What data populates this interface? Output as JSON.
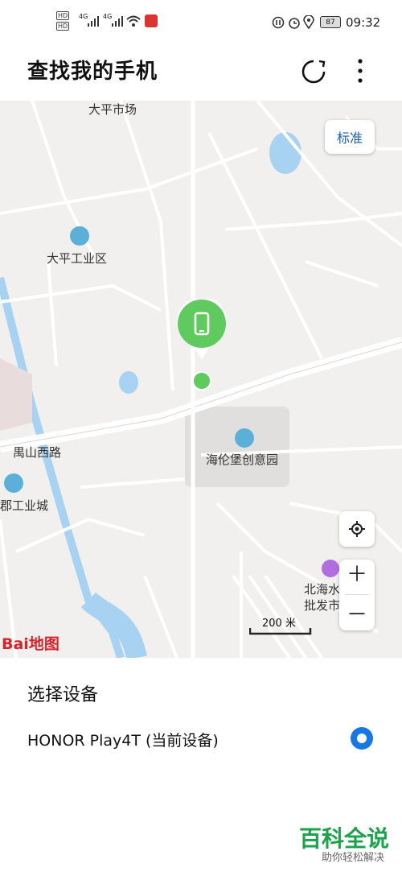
{
  "status_bar": {
    "signal_left": [
      "HD",
      "HD"
    ],
    "net1": "4G",
    "net2": "4G",
    "battery": "87",
    "time": "09:32"
  },
  "header": {
    "title": "查找我的手机"
  },
  "map": {
    "labels": {
      "dapingshichang": "大平市场",
      "dapinggongyequ": "大平工业区",
      "yushanxilu": "禺山西路",
      "hailunbao": "海伦堡创意园",
      "gongyecheng": "郡工业城",
      "beihai_line1": "北海水",
      "beihai_line2": "批发市"
    },
    "style_button": "标准",
    "scale": "200 米",
    "logo": "Bai地图",
    "colors": {
      "device_green": "#5fcb5f",
      "water": "#a7d2f2"
    }
  },
  "device_section": {
    "title": "选择设备",
    "device_name": "HONOR Play4T (当前设备)",
    "selected": true
  },
  "watermark": {
    "big": "百科全说",
    "small": "助你轻松解决"
  }
}
